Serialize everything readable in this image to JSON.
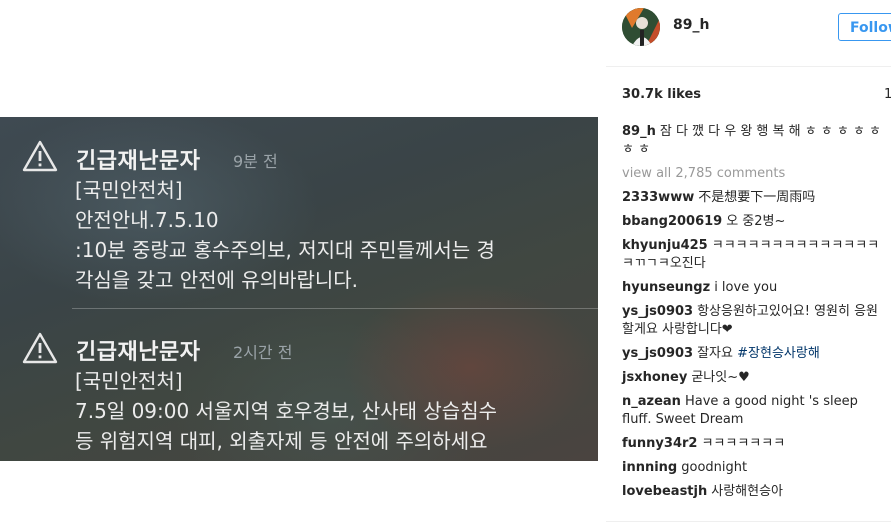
{
  "post": {
    "notifications": [
      {
        "title": "긴급재난문자",
        "time": "9분 전",
        "body": "[국민안전처]\n안전안내.7.5.10\n:10분 중랑교 홍수주의보, 저지대 주민들께서는 경\n각심을 갖고 안전에 유의바랍니다."
      },
      {
        "title": "긴급재난문자",
        "time": "2시간 전",
        "body": "[국민안전처]\n7.5일 09:00 서울지역 호우경보, 산사태 상습침수\n등 위험지역 대피, 외출자제 등 안전에 주의하세요"
      }
    ]
  },
  "header": {
    "username": "89_h",
    "follow_label": "Follow"
  },
  "likes": {
    "count": "30.7k likes",
    "right_fragment": "1"
  },
  "caption": {
    "user": "89_h",
    "text": "잠 다 깼 다 우 왕 행 복 해 ㅎ ㅎ ㅎ ㅎ ㅎ ㅎ ㅎ"
  },
  "view_all": "view all 2,785 comments",
  "comments": [
    {
      "user": "2333www",
      "text": "不是想要下一周雨吗"
    },
    {
      "user": "bbang200619",
      "text": "오 중2병~"
    },
    {
      "user": "khyunju425",
      "text": "ㅋㅋㅋㅋㅋㅋㅋㅋㅋㅋㅋㅋㅋㅋㅋㄲㄱㅋ오진다"
    },
    {
      "user": "hyunseungz",
      "text": "i love you"
    },
    {
      "user": "ys_js0903",
      "text": "항상응원하고있어요! 영원히 응원할게요 사랑합니다❤"
    },
    {
      "user": "ys_js0903",
      "text": "잘자요",
      "tag": "#장현승사랑해"
    },
    {
      "user": "jsxhoney",
      "text": "굳나잇~♥"
    },
    {
      "user": "n_azean",
      "text": "Have a good night 's sleep fluff. Sweet Dream "
    },
    {
      "user": "funny34r2",
      "text": "ㅋㅋㅋㅋㅋㅋㅋ"
    },
    {
      "user": "innning",
      "text": "goodnight"
    },
    {
      "user": "lovebeastjh",
      "text": "사랑해현승아"
    }
  ],
  "icons": {
    "warning": "warning-triangle-icon",
    "avatar": "avatar"
  },
  "colors": {
    "follow_blue": "#3897f0",
    "hashtag": "#003569",
    "muted": "#999999"
  }
}
